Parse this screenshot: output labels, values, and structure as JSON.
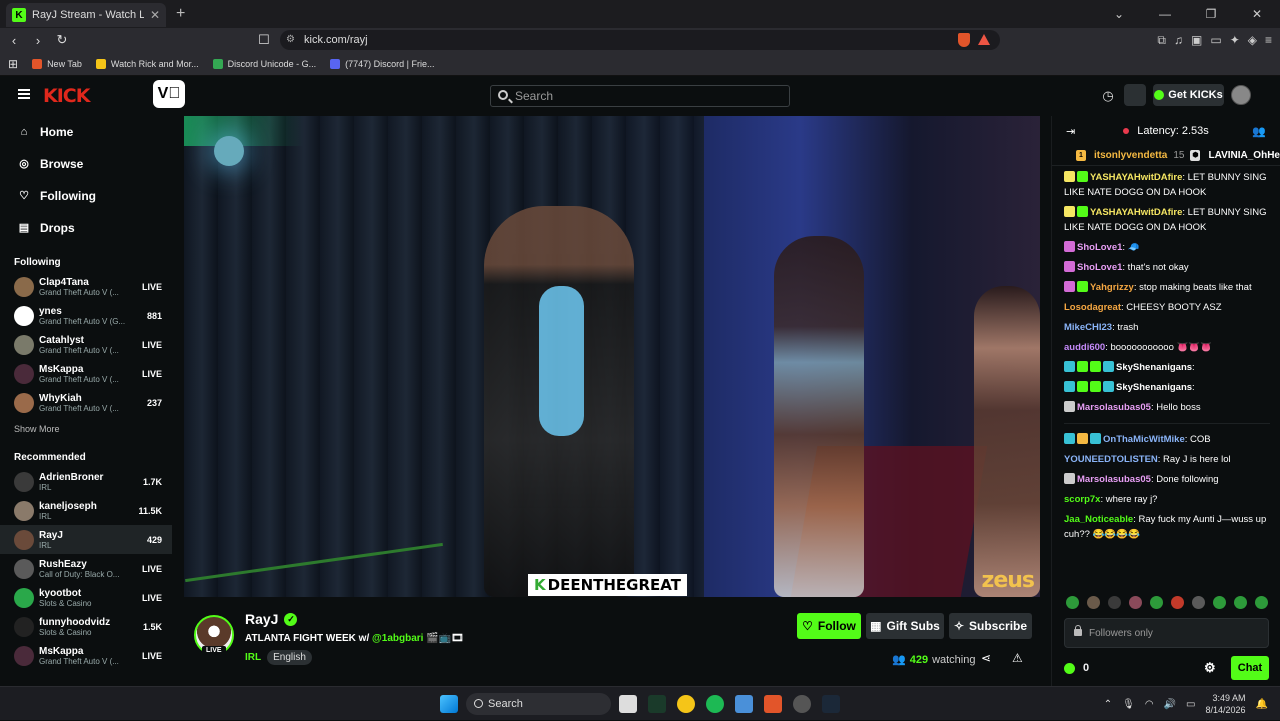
{
  "browser": {
    "tab_title": "RayJ Stream - Watch Live on",
    "url": "kick.com/rayj",
    "bookmarks": [
      {
        "label": "New Tab",
        "color": "#e2552a"
      },
      {
        "label": "Watch Rick and Mor...",
        "color": "#f5c518"
      },
      {
        "label": "Discord Unicode - G...",
        "color": "#34a853"
      },
      {
        "label": "(7747) Discord | Frie...",
        "color": "#5865f2"
      }
    ]
  },
  "header": {
    "logo": "KICK",
    "search_placeholder": "Search",
    "get_kicks": "Get KICKs"
  },
  "sidebar": {
    "nav": [
      {
        "label": "Home",
        "icon": "home-icon",
        "glyph": "⌂"
      },
      {
        "label": "Browse",
        "icon": "compass-icon",
        "glyph": "◎"
      },
      {
        "label": "Following",
        "icon": "heart-icon",
        "glyph": "♡"
      },
      {
        "label": "Drops",
        "icon": "drops-icon",
        "glyph": "▤"
      }
    ],
    "following_title": "Following",
    "following": [
      {
        "name": "Clap4Tana",
        "category": "Grand Theft Auto V (...",
        "status": "LIVE",
        "color": "#8a6a4a"
      },
      {
        "name": "ynes",
        "category": "Grand Theft Auto V (G...",
        "status": "881",
        "color": "#ffffff"
      },
      {
        "name": "Catahlyst",
        "category": "Grand Theft Auto V (...",
        "status": "LIVE",
        "color": "#7a7a6a"
      },
      {
        "name": "MsKappa",
        "category": "Grand Theft Auto V (...",
        "status": "LIVE",
        "color": "#4a2a3a"
      },
      {
        "name": "WhyKiah",
        "category": "Grand Theft Auto V (...",
        "status": "237",
        "color": "#9a6a4a"
      }
    ],
    "show_more": "Show More",
    "recommended_title": "Recommended",
    "recommended": [
      {
        "name": "AdrienBroner",
        "category": "IRL",
        "status": "1.7K",
        "color": "#3a3a3a"
      },
      {
        "name": "kaneljoseph",
        "category": "IRL",
        "status": "11.5K",
        "color": "#8a7a6a"
      },
      {
        "name": "RayJ",
        "category": "IRL",
        "status": "429",
        "color": "#6a4a3a",
        "active": true
      },
      {
        "name": "RushEazy",
        "category": "Call of Duty: Black O...",
        "status": "LIVE",
        "color": "#5a5a5a"
      },
      {
        "name": "kyootbot",
        "category": "Slots & Casino",
        "status": "LIVE",
        "color": "#2aa84a"
      },
      {
        "name": "funnyhoodvidz",
        "category": "Slots & Casino",
        "status": "1.5K",
        "color": "#222222"
      },
      {
        "name": "MsKappa",
        "category": "Grand Theft Auto V (...",
        "status": "LIVE",
        "color": "#4a2a3a"
      }
    ]
  },
  "video": {
    "overlay_tag": "DEENTHEGREAT",
    "sponsor": "zeus"
  },
  "stream": {
    "streamer": "RayJ",
    "live": "LIVE",
    "title_prefix": "ATLANTA FIGHT WEEK w/",
    "mention": "@1abgbari",
    "category": "IRL",
    "language": "English",
    "follow": "Follow",
    "gift_subs": "Gift Subs",
    "subscribe": "Subscribe",
    "viewers": "429",
    "watching_label": "watching"
  },
  "chat": {
    "latency": "Latency: 2.53s",
    "pinned_user1": "itsonlyvendetta",
    "pinned_count": "15",
    "pinned_user2": "LAVINIA_OhHe",
    "messages": [
      {
        "user": "YASHAYAHwitDAfire",
        "color": "#f5e663",
        "badges": [
          "#f5e663",
          "#53fc18"
        ],
        "text": ": LET BUNNY SING LIKE NATE DOGG ON DA HOOK"
      },
      {
        "user": "YASHAYAHwitDAfire",
        "color": "#f5e663",
        "badges": [
          "#f5e663",
          "#53fc18"
        ],
        "text": ": LET BUNNY SING LIKE NATE DOGG ON DA HOOK"
      },
      {
        "user": "ShoLove1",
        "color": "#e89ff5",
        "badges": [
          "#d36bd5"
        ],
        "text": ": 🧢"
      },
      {
        "user": "ShoLove1",
        "color": "#e89ff5",
        "badges": [
          "#d36bd5"
        ],
        "text": ": that's not okay"
      },
      {
        "user": "Yahgrizzy",
        "color": "#f5a742",
        "badges": [
          "#d36bd5",
          "#53fc18"
        ],
        "text": ": stop making beats like that"
      },
      {
        "user": "Losodagreat",
        "color": "#f5a742",
        "badges": [],
        "text": ": CHEESY BOOTY ASZ"
      },
      {
        "user": "MikeCHI23",
        "color": "#8ab4f8",
        "badges": [],
        "text": ": trash"
      },
      {
        "user": "auddi600",
        "color": "#c58af9",
        "badges": [],
        "text": ": booooooooooo 👅👅👅"
      },
      {
        "user": "SkyShenanigans",
        "color": "#ffffff",
        "badges": [
          "#38c1d5",
          "#53fc18",
          "#53fc18",
          "#38c1d5"
        ],
        "text": ":"
      },
      {
        "user": "SkyShenanigans",
        "color": "#ffffff",
        "badges": [
          "#38c1d5",
          "#53fc18",
          "#53fc18",
          "#38c1d5"
        ],
        "text": ":"
      },
      {
        "user": "Marsolasubas05",
        "color": "#e89ff5",
        "badges": [
          "#cccccc"
        ],
        "text": ": Hello boss"
      },
      {
        "user": "OnThaMicWitMike",
        "color": "#8ab4f8",
        "badges": [
          "#38c1d5",
          "#f5b942",
          "#38c1d5"
        ],
        "text": ": COB"
      },
      {
        "user": "YOUNEEDTOLISTEN",
        "color": "#8ab4f8",
        "badges": [],
        "text": ": Ray J is here lol"
      },
      {
        "user": "Marsolasubas05",
        "color": "#e89ff5",
        "badges": [
          "#cccccc"
        ],
        "text": ": Done following"
      },
      {
        "user": "scorp7x",
        "color": "#53fc18",
        "badges": [],
        "text": ": where ray j?"
      },
      {
        "user": "Jaa_Noticeable",
        "color": "#53fc18",
        "badges": [],
        "text": ": Ray fuck my Aunti J—wuss up cuh?? 😂😂😂😂"
      }
    ],
    "emotes": [
      "#2d9a3a",
      "#6a5a4a",
      "#3a3a3a",
      "#8a4a5a",
      "#2d9a3a",
      "#c23a2a",
      "#5a5a5a",
      "#2d9a3a",
      "#2d9a3a",
      "#2d9a3a"
    ],
    "input_placeholder": "Followers only",
    "coins": "0",
    "chat_button": "Chat"
  },
  "taskbar": {
    "search": "Search",
    "time": "3:49 AM",
    "date": "8/14/2026"
  }
}
